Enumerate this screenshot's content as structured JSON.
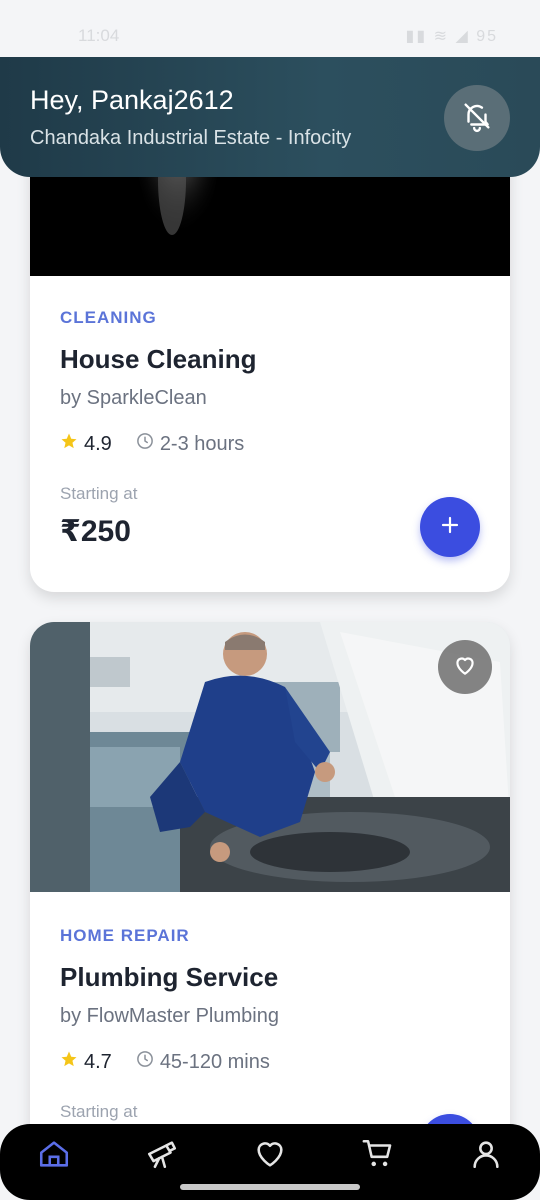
{
  "status_bar": {
    "time": "11:04",
    "right_text": "▮▮ ≋ ◢ 95"
  },
  "header": {
    "greeting": "Hey, Pankaj2612",
    "location": "Chandaka Industrial Estate - Infocity",
    "bell_icon": "bell-off-icon"
  },
  "services": [
    {
      "category": "CLEANING",
      "title": "House Cleaning",
      "provider": "by SparkleClean",
      "rating": "4.9",
      "duration": "2-3 hours",
      "starting_label": "Starting at",
      "price": "₹250"
    },
    {
      "category": "HOME REPAIR",
      "title": "Plumbing Service",
      "provider": "by FlowMaster Plumbing",
      "rating": "4.7",
      "duration": "45-120 mins",
      "starting_label": "Starting at",
      "price": ""
    }
  ],
  "nav": {
    "items": [
      "home-icon",
      "telescope-icon",
      "heart-icon",
      "cart-icon",
      "user-icon"
    ],
    "active": "home-icon",
    "active_color": "#5b6ee8"
  },
  "colors": {
    "accent": "#3b4de0",
    "category": "#5b74d8",
    "header": "#1f3a48"
  }
}
